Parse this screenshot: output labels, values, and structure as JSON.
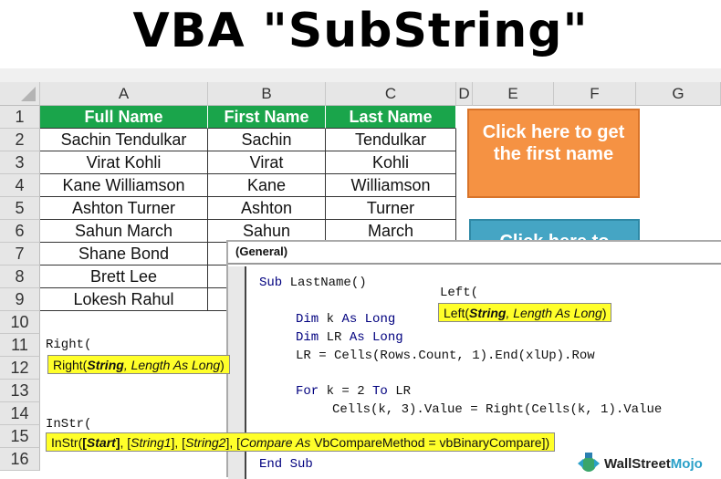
{
  "title": "VBA \"SubString\"",
  "sheet": {
    "columns": [
      "A",
      "B",
      "C",
      "D",
      "E",
      "F",
      "G"
    ],
    "row_numbers": [
      "1",
      "2",
      "3",
      "4",
      "5",
      "6",
      "7",
      "8",
      "9",
      "10",
      "11",
      "12",
      "13",
      "14",
      "15",
      "16"
    ],
    "headers": [
      "Full Name",
      "First Name",
      "Last Name"
    ],
    "rows": [
      [
        "Sachin Tendulkar",
        "Sachin",
        "Tendulkar"
      ],
      [
        "Virat Kohli",
        "Virat",
        "Kohli"
      ],
      [
        "Kane Williamson",
        "Kane",
        "Williamson"
      ],
      [
        "Ashton Turner",
        "Ashton",
        "Turner"
      ],
      [
        "Sahun March",
        "Sahun",
        "March"
      ],
      [
        "Shane Bond",
        "",
        ""
      ],
      [
        "Brett Lee",
        "",
        ""
      ],
      [
        "Lokesh Rahul",
        "",
        ""
      ]
    ],
    "header_color": "#1aa54b"
  },
  "buttons": {
    "first_name": "Click here to get the first name",
    "last_name": "Click here to"
  },
  "vbe": {
    "procedure_dropdown": "(General)",
    "code": {
      "sub": "Sub",
      "sub_name": " LastName()",
      "dim1_kw": "Dim",
      "dim1_var": " k ",
      "dim1_as": "As Long",
      "dim2_kw": "Dim",
      "dim2_var": " LR ",
      "dim2_as": "As Long",
      "lr_line": "LR = Cells(Rows.Count, 1).End(xlUp).Row",
      "for_kw": "For",
      "for_mid": " k = 2 ",
      "to_kw": "To",
      "for_end": " LR",
      "cells_line": "Cells(k, 3).Value = Right(Cells(k, 1).Value",
      "end_sub": "End Sub"
    }
  },
  "intellisense": {
    "left": {
      "typed": "Left(",
      "parts": [
        "Left(",
        "String",
        ", ",
        "Length As Long",
        ")"
      ]
    },
    "right": {
      "typed": "Right(",
      "parts": [
        "Right(",
        "String",
        ", ",
        "Length As Long",
        ")"
      ]
    },
    "instr": {
      "typed": "InStr(",
      "parts": [
        "InStr(",
        "[",
        "Start",
        "]",
        ", [",
        "String1",
        "], [",
        "String2",
        "], [",
        "Compare As",
        " VbCompareMethod = vbBinaryCompare])"
      ]
    },
    "tooltip_color": "#ffff2a"
  },
  "logo": {
    "part1": "WallStreet",
    "part2": "Mojo"
  }
}
